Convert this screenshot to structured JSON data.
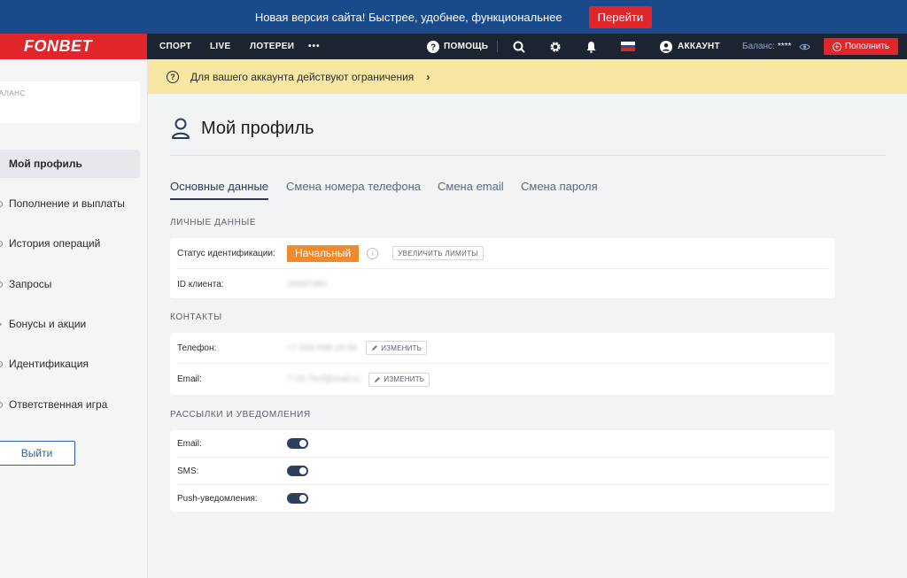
{
  "promo": {
    "text": "Новая версия сайта! Быстрее, удобнее, функциональнее",
    "button": "Перейти"
  },
  "header": {
    "logo": "FONBET",
    "nav": [
      "СПОРТ",
      "LIVE",
      "ЛОТЕРЕИ"
    ],
    "more": "•••",
    "help": "ПОМОЩЬ",
    "account": "АККАУНТ",
    "balance_label": "Баланс:",
    "balance_value": "****",
    "deposit": "Пополнить"
  },
  "sidebar": {
    "balance_label": "БАЛАНС",
    "items": [
      "Мой профиль",
      "Пополнение и выплаты",
      "История операций",
      "Запросы",
      "Бонусы и акции",
      "Идентификация",
      "Ответственная игра"
    ],
    "logout": "Выйти"
  },
  "warning": {
    "text": "Для вашего аккаунта действуют ограничения",
    "arrow": "›"
  },
  "main": {
    "title": "Мой профиль",
    "tabs": [
      "Основные данные",
      "Смена номера телефона",
      "Смена email",
      "Смена пароля"
    ],
    "personal": {
      "heading": "ЛИЧНЫЕ ДАННЫЕ",
      "status_label": "Статус идентификации:",
      "status_value": "Начальный",
      "increase_limits": "УВЕЛИЧИТЬ ЛИМИТЫ",
      "client_id_label": "ID клиента:",
      "client_id_value": "20937384"
    },
    "contacts": {
      "heading": "КОНТАКТЫ",
      "phone_label": "Телефон:",
      "phone_value": "+7 933 998-16-94",
      "email_label": "Email:",
      "email_value": "7-16-7ecf@mail.ru",
      "edit": "ИЗМЕНИТЬ"
    },
    "notifications": {
      "heading": "РАССЫЛКИ И УВЕДОМЛЕНИЯ",
      "email_label": "Email:",
      "sms_label": "SMS:",
      "push_label": "Push-уведомления:",
      "email_on": true,
      "sms_on": true,
      "push_on": true
    }
  },
  "colors": {
    "brand_red": "#e0262a",
    "header_dark": "#1c2431",
    "banner_blue": "#1a4a8a",
    "warn_yellow": "#f7e7a3",
    "badge_orange": "#f08a2c",
    "toggle_navy": "#2d3f5f"
  }
}
